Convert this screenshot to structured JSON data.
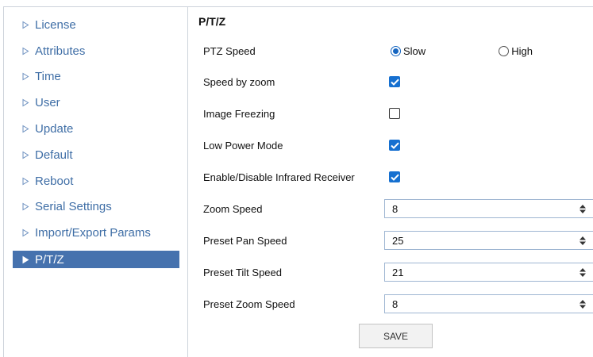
{
  "sidebar": {
    "items": [
      {
        "label": "License"
      },
      {
        "label": "Attributes"
      },
      {
        "label": "Time"
      },
      {
        "label": "User"
      },
      {
        "label": "Update"
      },
      {
        "label": "Default"
      },
      {
        "label": "Reboot"
      },
      {
        "label": "Serial Settings"
      },
      {
        "label": "Import/Export Params"
      },
      {
        "label": "P/T/Z",
        "active": true
      }
    ]
  },
  "main": {
    "title": "P/T/Z",
    "ptz_speed": {
      "label": "PTZ Speed",
      "options": [
        "Slow",
        "High"
      ],
      "selected": "Slow"
    },
    "speed_by_zoom": {
      "label": "Speed by zoom",
      "checked": true
    },
    "image_freezing": {
      "label": "Image Freezing",
      "checked": false
    },
    "low_power_mode": {
      "label": "Low Power Mode",
      "checked": true
    },
    "infrared_receiver": {
      "label": "Enable/Disable Infrared Receiver",
      "checked": true
    },
    "zoom_speed": {
      "label": "Zoom Speed",
      "value": "8"
    },
    "preset_pan_speed": {
      "label": "Preset Pan Speed",
      "value": "25"
    },
    "preset_tilt_speed": {
      "label": "Preset Tilt Speed",
      "value": "21"
    },
    "preset_zoom_speed": {
      "label": "Preset Zoom Speed",
      "value": "8"
    },
    "save_label": "SAVE"
  },
  "colors": {
    "sidebar_text": "#3f6ea6",
    "active_bg": "#4672ae",
    "accent": "#1670d0"
  }
}
